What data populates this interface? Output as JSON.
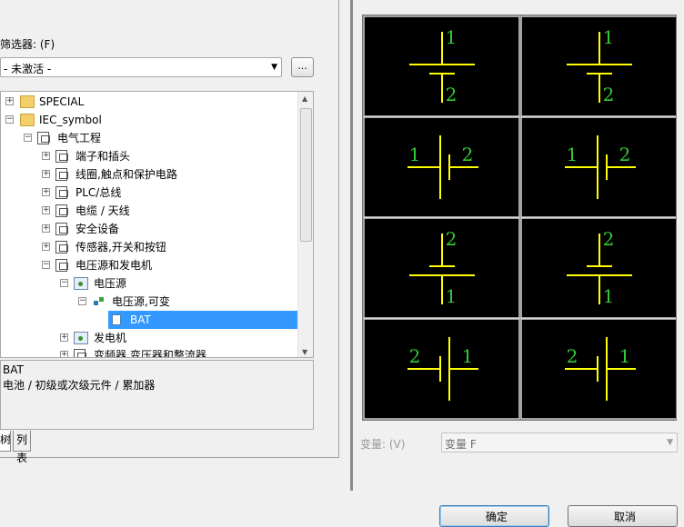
{
  "filter": {
    "label": "筛选器: (F)",
    "selected": "- 未激活 -",
    "browse_label": "..."
  },
  "tree": {
    "items": [
      {
        "label": "SPECIAL",
        "expander": "+"
      },
      {
        "label": "IEC_symbol",
        "expander": "−"
      },
      {
        "label": "电气工程",
        "expander": "−"
      },
      {
        "label": "端子和插头",
        "expander": "+"
      },
      {
        "label": "线圈,触点和保护电路",
        "expander": "+"
      },
      {
        "label": "PLC/总线",
        "expander": "+"
      },
      {
        "label": "电缆 / 天线",
        "expander": "+"
      },
      {
        "label": "安全设备",
        "expander": "+"
      },
      {
        "label": "传感器,开关和按钮",
        "expander": "+"
      },
      {
        "label": "电压源和发电机",
        "expander": "−"
      },
      {
        "label": "电压源",
        "expander": "−"
      },
      {
        "label": "电压源,可变",
        "expander": "−"
      },
      {
        "label": "BAT",
        "expander": ""
      },
      {
        "label": "发电机",
        "expander": "+"
      },
      {
        "label": "变频器,变压器和整流器",
        "expander": "+"
      }
    ]
  },
  "description": {
    "line1": "BAT",
    "line2": "电池 / 初级或次级元件 / 累加器"
  },
  "tabs": [
    {
      "label": "树"
    },
    {
      "label": "列表"
    }
  ],
  "preview": {
    "symbol_color": "#ffff00",
    "pin_color": "#33cc33",
    "cells": [
      {
        "orientation": "vertical",
        "top_pin": "1",
        "bottom_pin": "2"
      },
      {
        "orientation": "vertical",
        "top_pin": "1",
        "bottom_pin": "2"
      },
      {
        "orientation": "horizontal",
        "left_pin": "1",
        "right_pin": "2"
      },
      {
        "orientation": "horizontal",
        "left_pin": "1",
        "right_pin": "2"
      },
      {
        "orientation": "vertical",
        "top_pin": "2",
        "bottom_pin": "1"
      },
      {
        "orientation": "vertical",
        "top_pin": "2",
        "bottom_pin": "1"
      },
      {
        "orientation": "horizontal",
        "left_pin": "2",
        "right_pin": "1"
      },
      {
        "orientation": "horizontal",
        "left_pin": "2",
        "right_pin": "1"
      }
    ]
  },
  "variant": {
    "label": "变量: (V)",
    "selected": "变量 F"
  },
  "buttons": {
    "ok_label": "确定",
    "cancel_label": "取消"
  }
}
